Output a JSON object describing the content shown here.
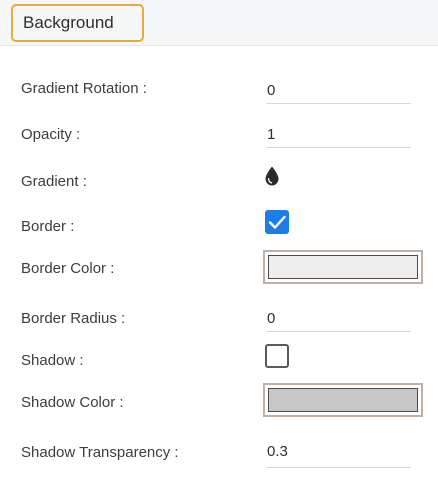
{
  "section": {
    "title": "Background"
  },
  "fields": {
    "gradient_rotation": {
      "label": "Gradient Rotation :",
      "value": "0"
    },
    "opacity": {
      "label": "Opacity :",
      "value": "1"
    },
    "gradient": {
      "label": "Gradient :",
      "icon": "water-drop-icon"
    },
    "border": {
      "label": "Border :",
      "checked": true
    },
    "border_color": {
      "label": "Border Color :",
      "color": "#eeeeee"
    },
    "border_radius": {
      "label": "Border Radius :",
      "value": "0"
    },
    "shadow": {
      "label": "Shadow :",
      "checked": false
    },
    "shadow_color": {
      "label": "Shadow Color :",
      "color": "#c8c8c8"
    },
    "shadow_transparency": {
      "label": "Shadow Transparency :",
      "value": "0.3"
    }
  },
  "colors": {
    "accent": "#e8a93d",
    "checkbox_checked": "#1b7ee8"
  }
}
